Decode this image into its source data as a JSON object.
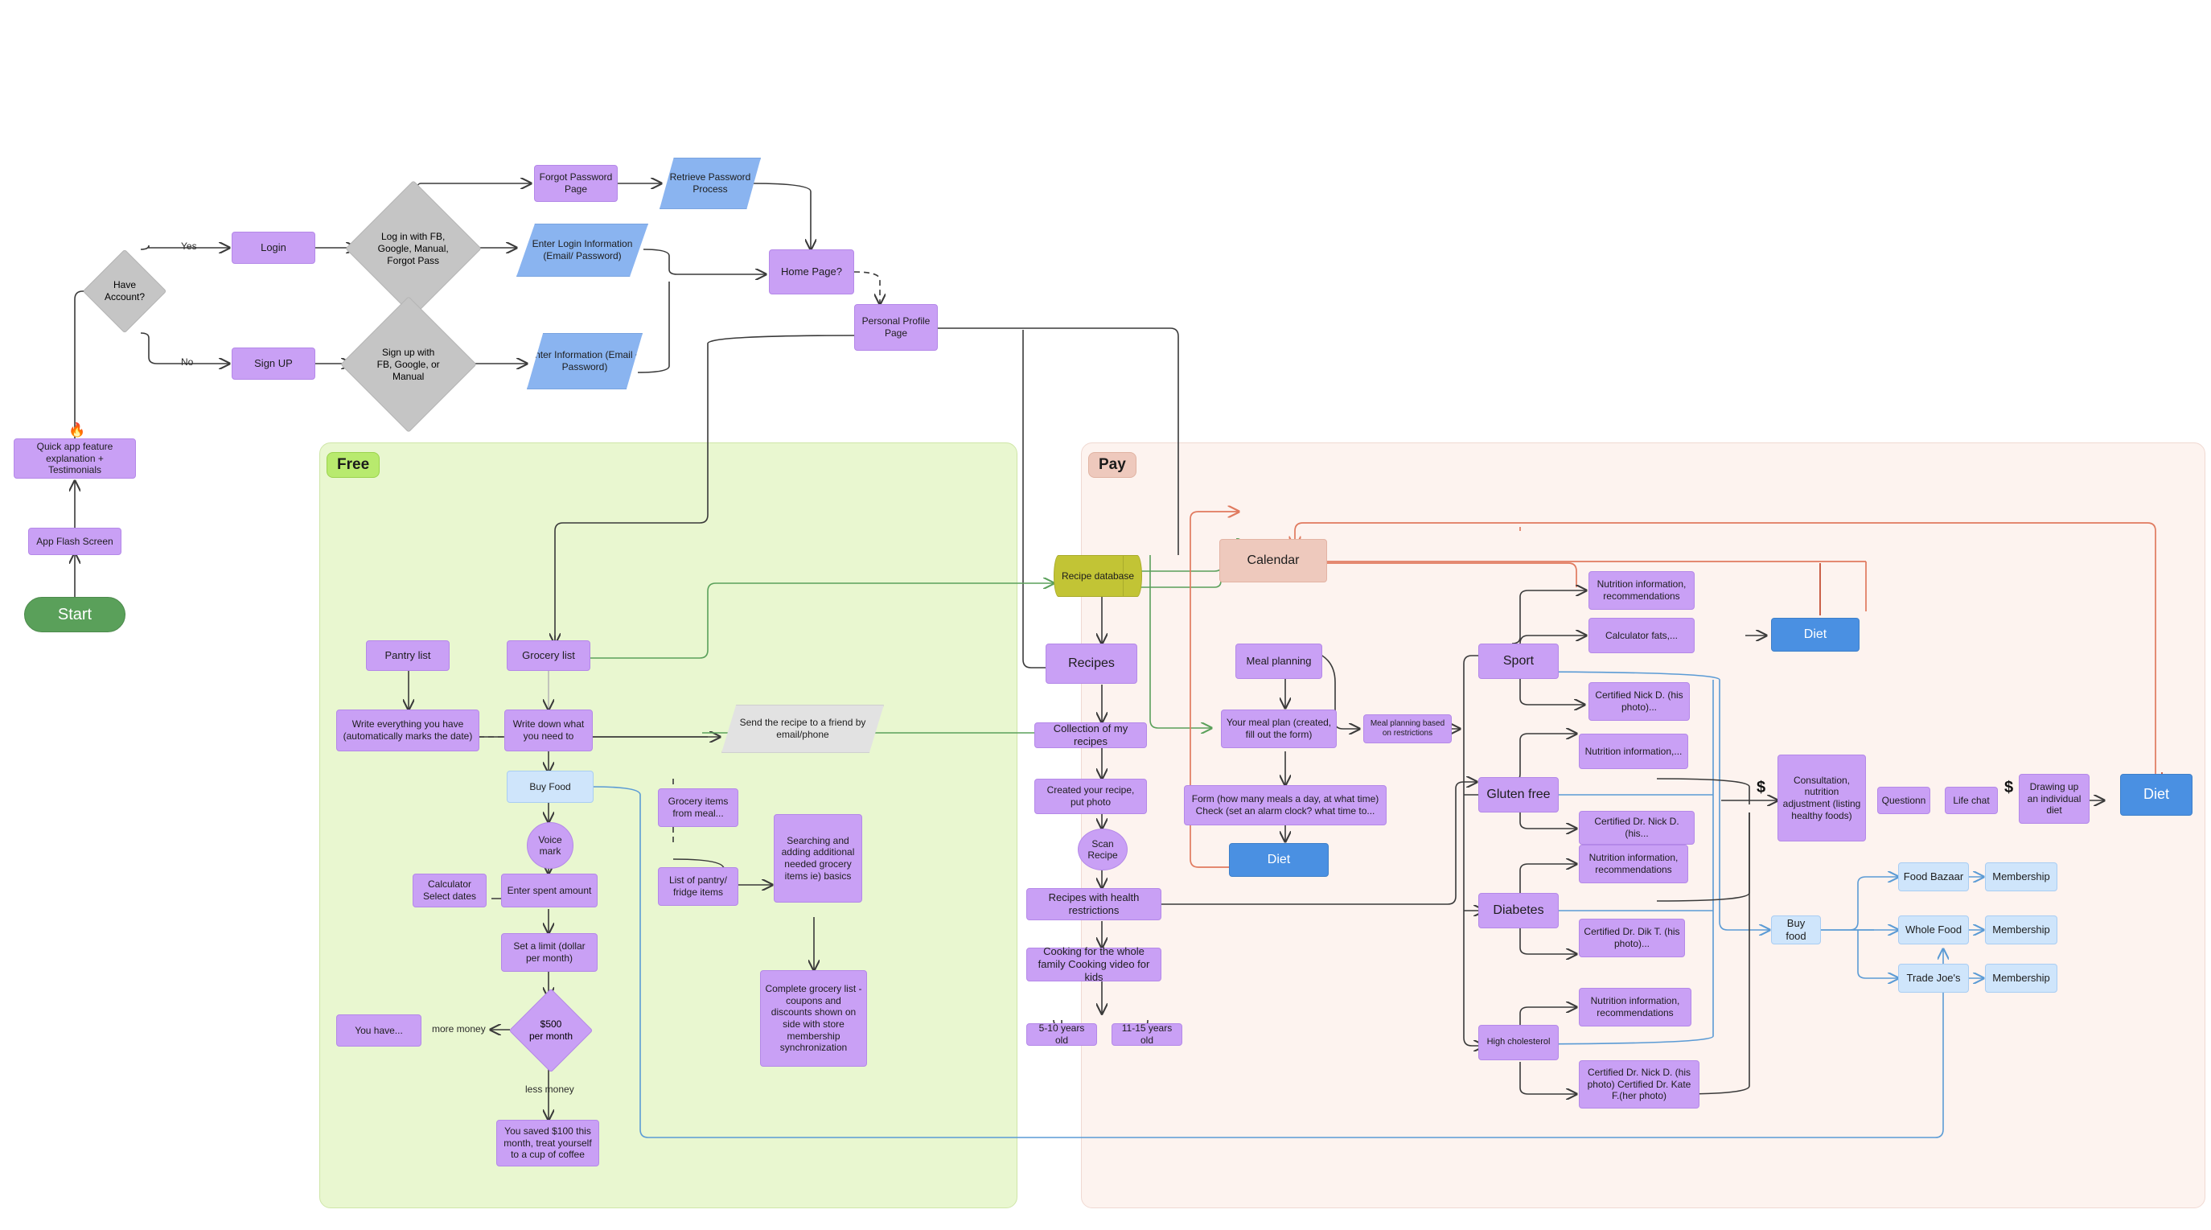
{
  "zones": {
    "free": {
      "label": "Free"
    },
    "pay": {
      "label": "Pay"
    }
  },
  "nodes": {
    "start": "Start",
    "app_flash_screen": "App Flash Screen",
    "quick_app_feature": "Quick app feature explanation + Testimonials",
    "have_account": "Have Account?",
    "yes_label": "Yes",
    "no_label": "No",
    "login": "Login",
    "sign_up": "Sign UP",
    "login_with": "Log in with FB, Google, Manual, Forgot Pass",
    "signup_with": "Sign up  with FB, Google, or Manual",
    "forgot_password_page": "Forgot Password Page",
    "retrieve_password_process": "Retrieve Password Process",
    "enter_login_information": "Enter Login Information (Email/ Password)",
    "enter_information": "Enter Information (Email + Password)",
    "home_page": "Home Page?",
    "personal_profile_page": "Personal Profile Page",
    "pantry_list": "Pantry list",
    "grocery_list": "Grocery list",
    "write_everything": "Write everything you have (automatically marks the date)",
    "write_down": "Write down what you need to",
    "buy_food_free": "Buy Food",
    "voice_mark": "Voice mark",
    "calculator_select_dates": "Calculator Select dates",
    "enter_spent_amount": "Enter spent amount",
    "set_a_limit": "Set a limit (dollar per month)",
    "five_hundred_per_month": "$500 per month",
    "more_money": "more money",
    "less_money": "less money",
    "you_have": "You have...",
    "you_saved": "You saved $100 this month, treat yourself to a cup of coffee",
    "send_recipe": "Send the recipe to a friend by email/phone",
    "grocery_items_from_meal": "Grocery items from meal...",
    "list_of_pantry_fridge": "List of pantry/ fridge items",
    "searching_adding": "Searching and adding additional needed grocery items ie) basics",
    "complete_grocery_list": "Complete grocery list - coupons and discounts shown on side with store membership synchronization",
    "recipe_database": "Recipe database",
    "recipes": "Recipes",
    "collection_of_my_recipes": "Collection of my recipes",
    "created_your_recipe": "Created your recipe, put photo",
    "scan_recipe": "Scan Recipe",
    "recipes_health_restrictions": "Recipes with health restrictions",
    "cooking_whole_family": "Cooking for the whole family Cooking video for kids",
    "age_5_10": "5-10 years old",
    "age_11_15": "11-15 years old",
    "calendar": "Calendar",
    "meal_planning": "Meal planning",
    "your_meal_plan": "Your meal plan (created, fill out the form)",
    "meal_planning_restrictions": "Meal planning based on restrictions",
    "form_how_many_meals": "Form (how many meals a day, at what time) Check (set an alarm clock? what time to...",
    "diet_meal": "Diet",
    "sport": "Sport",
    "gluten_free": "Gluten free",
    "diabetes": "Diabetes",
    "high_cholesterol": "High cholesterol",
    "nutrition_info_rec_1": "Nutrition information, recommendations",
    "calculator_fats": "Calculator fats,...",
    "certified_nick_d_1": "Certified  Nick D. (his photo)...",
    "nutrition_info_2": "Nutrition information,...",
    "certified_dr_nick_d_2": "Certified  Dr. Nick D.(his...",
    "nutrition_info_rec_3": "Nutrition information, recommendations",
    "certified_dr_dik_t": "Certified  Dr. Dik T. (his photo)...",
    "nutrition_info_rec_4": "Nutrition information, recommendations",
    "certified_dr_nick_kate": "Certified  Dr. Nick D. (his photo) Certified Dr. Kate F.(her photo)",
    "diet_top": "Diet",
    "consultation": "Consultation, nutrition adjustment (listing healthy foods)",
    "questionn": "Questionn",
    "life_chat": "Life chat",
    "drawing_individual_diet": "Drawing up an individual diet",
    "diet_right": "Diet",
    "buy_food_pay": "Buy food",
    "food_bazaar": "Food Bazaar",
    "whole_food": "Whole Food",
    "trade_joes": "Trade Joe's",
    "membership_1": "Membership",
    "membership_2": "Membership",
    "membership_3": "Membership",
    "dollar_1": "$",
    "dollar_2": "$"
  },
  "colors": {
    "purple": "#c9a0f5",
    "gray": "#c5c5c5",
    "blue": "#8ab4f0",
    "light_blue": "#cfe5fb",
    "blue_solid": "#4a90e2",
    "green_start": "#5aa05a",
    "salmon": "#eec9bd",
    "olive": "#c2c435",
    "free_zone": "#e9f7d0",
    "pay_zone": "#fdf3ef"
  }
}
